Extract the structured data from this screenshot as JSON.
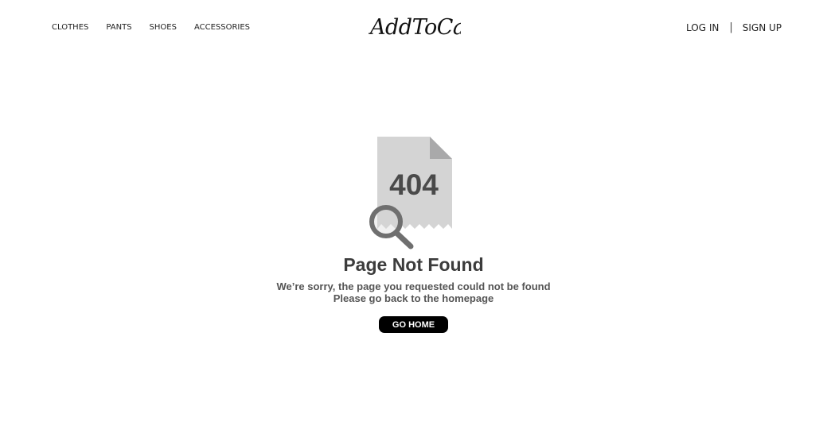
{
  "header": {
    "nav_left": [
      {
        "label": "CLOTHES"
      },
      {
        "label": "PANTS"
      },
      {
        "label": "SHOES"
      },
      {
        "label": "ACCESSORIES"
      }
    ],
    "logo_text": "AddToCart",
    "auth": {
      "login_label": "LOG IN",
      "separator": "|",
      "signup_label": "SIGN UP"
    }
  },
  "error": {
    "code": "404",
    "icon": "magnifying-glass-icon",
    "title": "Page Not Found",
    "message_line1": "We’re sorry, the page you requested could not be found",
    "message_line2": "Please go back to the homepage",
    "button_label": "GO HOME"
  },
  "colors": {
    "background": "#ffffff",
    "document": "#d4d4d4",
    "document_fold": "#a9a9aa",
    "magnifier": "#6f6f6f",
    "button_bg": "#000000",
    "button_text": "#ffffff"
  }
}
